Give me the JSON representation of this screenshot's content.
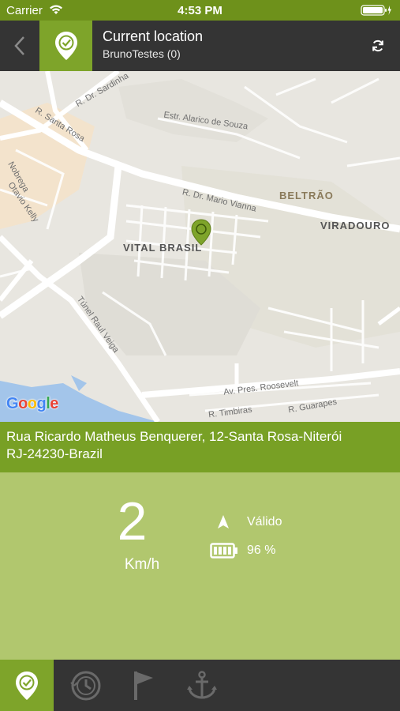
{
  "status_bar": {
    "carrier": "Carrier",
    "time": "4:53 PM"
  },
  "header": {
    "title": "Current location",
    "subtitle": "BrunoTestes (0)",
    "icons": [
      "back-chevron-icon",
      "location-check-icon",
      "refresh-icon"
    ]
  },
  "map": {
    "labels": {
      "r_dr_sardinha": "R. Dr. Sardinha",
      "r_santa_rosa": "R. Santa Rosa",
      "estr_alarico": "Estr. Alarico de Souza",
      "r_dr_mario_vianna": "R. Dr. Mario Vianna",
      "beltrao": "BELTRÃO",
      "viradouro": "VIRADOURO",
      "vital_brasil": "VITAL BRASIL",
      "nobrega": "Nobrega",
      "otavio_kelly": "Otavio Kelly",
      "tunel_raul_veiga": "Túnel Raul Veiga",
      "av_pres_roosevelt": "Av. Pres. Roosevelt",
      "r_timbiras": "R. Timbiras",
      "r_guararapes": "R. Guarapes"
    },
    "logo": "Google"
  },
  "address": {
    "line1": "Rua Ricardo Matheus Benquerer, 12-Santa Rosa-Niterói",
    "line2": "RJ-24230-Brazil"
  },
  "info": {
    "speed": "2",
    "speed_unit": "Km/h",
    "gps_status": "Válido",
    "battery": "96 %",
    "battery_level": 0.96
  },
  "tabbar": {
    "tabs": [
      "location-tab",
      "history-tab",
      "flag-tab",
      "anchor-tab"
    ],
    "active": "location-tab"
  },
  "colors": {
    "status_bar": "#6e911b",
    "header": "#343434",
    "accent": "#7ea42a",
    "address_bg": "#78a025",
    "info_bg": "#b1c76e",
    "tabbar": "#343434"
  }
}
